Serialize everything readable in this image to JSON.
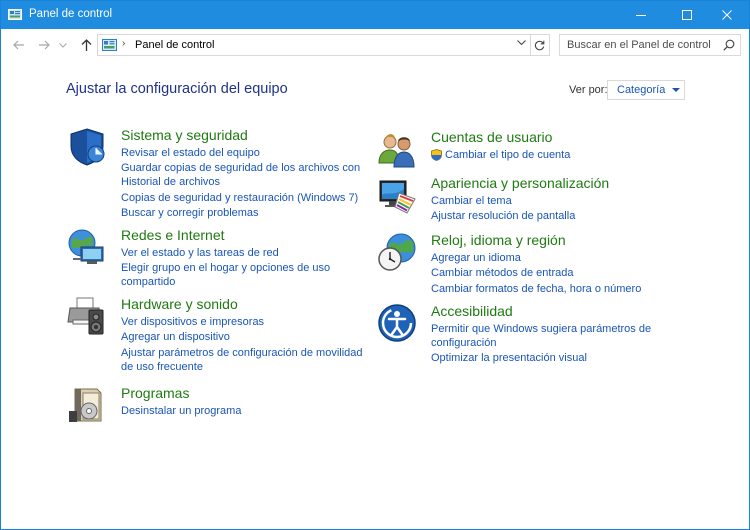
{
  "window": {
    "title": "Panel de control"
  },
  "address": {
    "crumb": "Panel de control",
    "separator": "›"
  },
  "search": {
    "placeholder": "Buscar en el Panel de control"
  },
  "heading": "Ajustar la configuración del equipo",
  "view_by": {
    "label": "Ver por:",
    "value": "Categoría"
  },
  "colors": {
    "titlebar": "#1f8ce0",
    "heading": "#1e3287",
    "category_title": "#1f7a12",
    "link": "#1a55b5"
  },
  "categories_left": [
    {
      "title": "Sistema y seguridad",
      "icon": "shield-icon",
      "links": [
        "Revisar el estado del equipo",
        "Guardar copias de seguridad de los archivos con Historial de archivos",
        "Copias de seguridad y restauración (Windows 7)",
        "Buscar y corregir problemas"
      ]
    },
    {
      "title": "Redes e Internet",
      "icon": "globe-network-icon",
      "links": [
        "Ver el estado y las tareas de red",
        "Elegir grupo en el hogar y opciones de uso compartido"
      ]
    },
    {
      "title": "Hardware y sonido",
      "icon": "printer-speaker-icon",
      "links": [
        "Ver dispositivos e impresoras",
        "Agregar un dispositivo",
        "Ajustar parámetros de configuración de movilidad de uso frecuente"
      ]
    },
    {
      "title": "Programas",
      "icon": "programs-box-icon",
      "links": [
        "Desinstalar un programa"
      ]
    }
  ],
  "categories_right": [
    {
      "title": "Cuentas de usuario",
      "icon": "users-icon",
      "links": [
        "Cambiar el tipo de cuenta"
      ]
    },
    {
      "title": "Apariencia y personalización",
      "icon": "monitor-palette-icon",
      "links": [
        "Cambiar el tema",
        "Ajustar resolución de pantalla"
      ]
    },
    {
      "title": "Reloj, idioma y región",
      "icon": "clock-globe-icon",
      "links": [
        "Agregar un idioma",
        "Cambiar métodos de entrada",
        "Cambiar formatos de fecha, hora o número"
      ]
    },
    {
      "title": "Accesibilidad",
      "icon": "accessibility-icon",
      "links": [
        "Permitir que Windows sugiera parámetros de configuración",
        "Optimizar la presentación visual"
      ]
    }
  ]
}
